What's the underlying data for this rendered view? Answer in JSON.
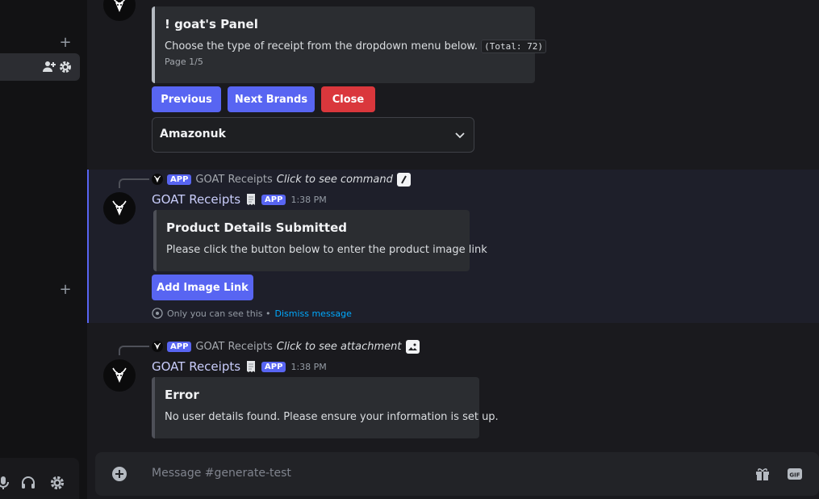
{
  "composer": {
    "placeholder": "Message #generate-test"
  },
  "panel_message": {
    "embed_title": "! goat's Panel",
    "embed_desc": "Choose the type of receipt from the dropdown menu below.",
    "embed_code": "(Total: 72)",
    "embed_footer": "Page 1/5",
    "buttons": {
      "previous": "Previous",
      "next": "Next Brands",
      "close": "Close"
    },
    "select_value": "Amazonuk"
  },
  "product_message": {
    "reply": {
      "app_tag": "APP",
      "name": "GOAT Receipts",
      "action": "Click to see command"
    },
    "author": "GOAT Receipts",
    "app_tag": "APP",
    "time": "1:38 PM",
    "embed_title": "Product Details Submitted",
    "embed_desc": "Please click the button below to enter the product image link",
    "button": "Add Image Link",
    "ephemeral_note": "Only you can see this •",
    "dismiss": "Dismiss message"
  },
  "error_message": {
    "reply": {
      "app_tag": "APP",
      "name": "GOAT Receipts",
      "action": "Click to see attachment"
    },
    "author": "GOAT Receipts",
    "app_tag": "APP",
    "time": "1:38 PM",
    "embed_title": "Error",
    "embed_desc": "No user details found. Please ensure your information is set up."
  },
  "colors": {
    "blurple": "#5865f2",
    "danger": "#da373c",
    "link": "#00a8fc"
  },
  "icons": [
    "plus-icon",
    "add-member-icon",
    "gear-icon",
    "microphone-icon",
    "headphones-icon",
    "goat-avatar",
    "receipt-icon",
    "slash-command-icon",
    "image-icon",
    "chevron-down-icon",
    "eye-icon",
    "gift-icon",
    "gif-icon"
  ]
}
